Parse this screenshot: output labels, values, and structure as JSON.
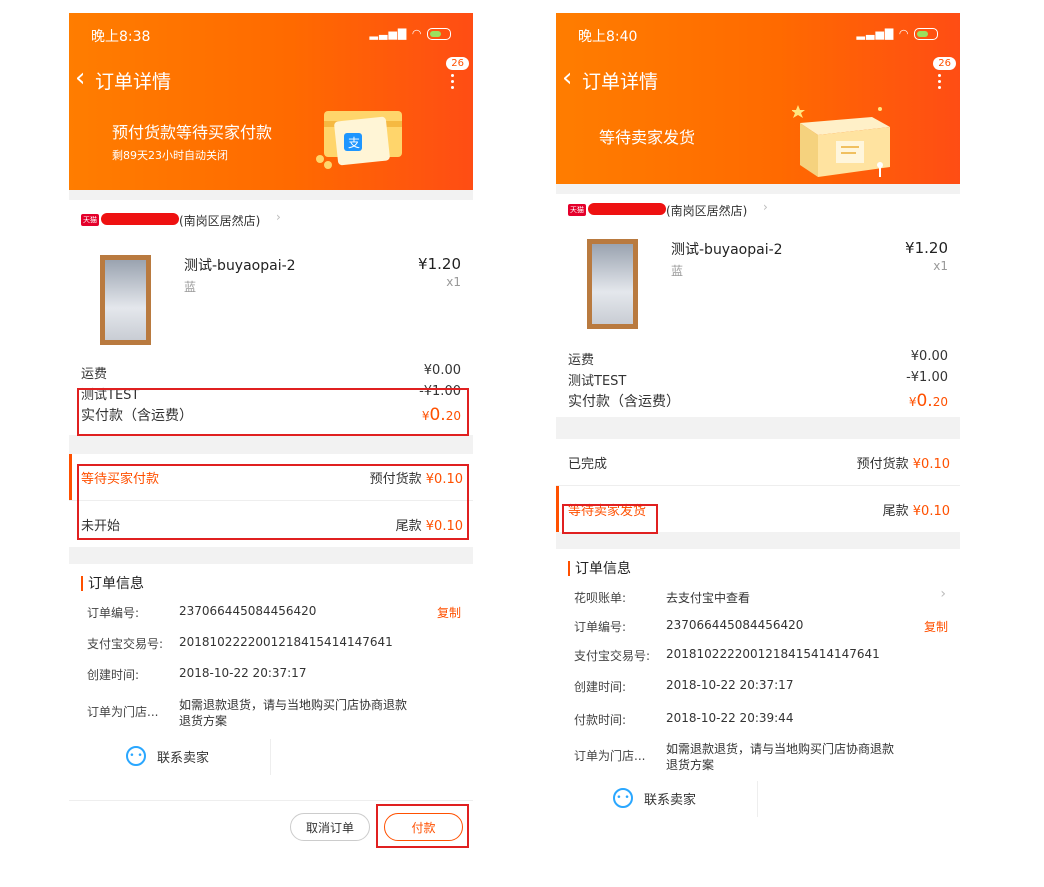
{
  "left": {
    "status_time": "晚上8:38",
    "title": "订单详情",
    "badge": "26",
    "status_main": "预付货款等待买家付款",
    "status_sub": "剩89天23小时自动关闭",
    "shop_tag": "天猫",
    "shop_name": "(南岗区居然店)",
    "product": {
      "name": "测试-buyaopai-2",
      "sku": "蓝",
      "price": "¥1.20",
      "qty": "x1"
    },
    "fees": [
      {
        "label": "运费",
        "value": "¥0.00"
      },
      {
        "label": "测试TEST",
        "value": "-¥1.00"
      }
    ],
    "paid_label": "实付款（含运费）",
    "paid_currency": "¥",
    "paid_int": "0.",
    "paid_dec": "20",
    "stages": [
      {
        "status": "等待买家付款",
        "kind": "预付货款",
        "amount": "¥0.10"
      },
      {
        "status": "未开始",
        "kind": "尾款",
        "amount": "¥0.10"
      }
    ],
    "info_title": "订单信息",
    "info": [
      {
        "k": "订单编号:",
        "v": "237066445084456420",
        "copy": "复制"
      },
      {
        "k": "支付宝交易号:",
        "v": "2018102222001218415414147641"
      },
      {
        "k": "创建时间:",
        "v": "2018-10-22 20:37:17"
      },
      {
        "k": "订单为门店...",
        "v": "如需退款退货，请与当地购买门店协商退款退货方案"
      }
    ],
    "contact": "联系卖家",
    "cancel": "取消订单",
    "pay": "付款"
  },
  "right": {
    "status_time": "晚上8:40",
    "title": "订单详情",
    "badge": "26",
    "status_main": "等待卖家发货",
    "shop_tag": "天猫",
    "shop_name": "(南岗区居然店)",
    "product": {
      "name": "测试-buyaopai-2",
      "sku": "蓝",
      "price": "¥1.20",
      "qty": "x1"
    },
    "fees": [
      {
        "label": "运费",
        "value": "¥0.00"
      },
      {
        "label": "测试TEST",
        "value": "-¥1.00"
      }
    ],
    "paid_label": "实付款（含运费）",
    "paid_currency": "¥",
    "paid_int": "0.",
    "paid_dec": "20",
    "stages": [
      {
        "status": "已完成",
        "kind": "预付货款",
        "amount": "¥0.10"
      },
      {
        "status": "等待卖家发货",
        "kind": "尾款",
        "amount": "¥0.10"
      }
    ],
    "info_title": "订单信息",
    "info": [
      {
        "k": "花呗账单:",
        "v": "去支付宝中查看"
      },
      {
        "k": "订单编号:",
        "v": "237066445084456420",
        "copy": "复制"
      },
      {
        "k": "支付宝交易号:",
        "v": "2018102222001218415414147641"
      },
      {
        "k": "创建时间:",
        "v": "2018-10-22 20:37:17"
      },
      {
        "k": "付款时间:",
        "v": "2018-10-22 20:39:44"
      },
      {
        "k": "订单为门店...",
        "v": "如需退款退货，请与当地购买门店协商退款退货方案"
      }
    ],
    "contact": "联系卖家"
  },
  "colors": {
    "accent": "#ff5000",
    "header_start": "#ff7d00",
    "header_end": "#ff4d14",
    "highlight": "#e02020"
  },
  "icons": [
    "back-chevron-icon",
    "more-icon",
    "signal-icon",
    "wifi-icon",
    "battery-icon",
    "tmall-icon",
    "alipay-card-icon",
    "package-box-icon",
    "chat-face-icon"
  ]
}
